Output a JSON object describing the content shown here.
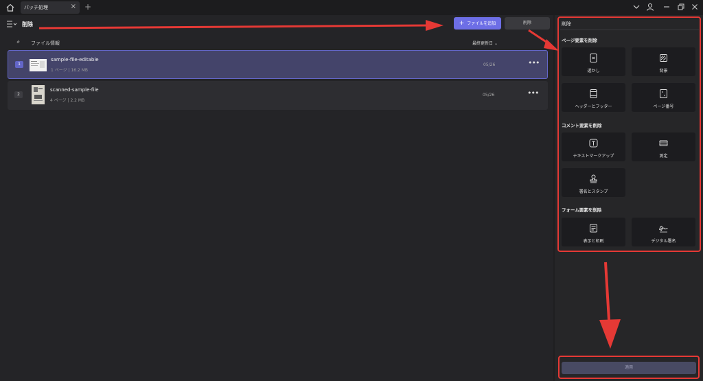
{
  "titlebar": {
    "tab_label": "バッチ処理",
    "tab_close": "×",
    "tab_add": "+",
    "controls": [
      "chevron-down-icon",
      "account-icon",
      "minimize-icon",
      "restore-icon",
      "close-icon"
    ]
  },
  "toolbar": {
    "title": "削除",
    "add_files_label": "ファイルを追加",
    "delete_label": "削除"
  },
  "table": {
    "col_hash": "#",
    "col_info": "ファイル情報",
    "col_date": "最終更新日"
  },
  "files": [
    {
      "index": "1",
      "name": "sample-file-editable",
      "pages": "1 ページ",
      "size": "16.2 MB",
      "date": "05/26",
      "more": "•••"
    },
    {
      "index": "2",
      "name": "scanned-sample-file",
      "pages": "4 ページ",
      "size": "2.2 MB",
      "date": "05/26",
      "more": "•••"
    }
  ],
  "panel": {
    "title": "削除",
    "page_section": "ページ要素を削除",
    "page_items": [
      {
        "label": "透かし",
        "icon": "watermark-icon"
      },
      {
        "label": "背景",
        "icon": "background-icon"
      },
      {
        "label": "ヘッダーとフッター",
        "icon": "header-footer-icon"
      },
      {
        "label": "ページ番号",
        "icon": "page-number-icon"
      }
    ],
    "comment_section": "コメント要素を削除",
    "comment_items": [
      {
        "label": "テキストマークアップ",
        "icon": "text-markup-icon"
      },
      {
        "label": "測定",
        "icon": "measure-icon"
      },
      {
        "label": "署名とスタンプ",
        "icon": "stamp-icon"
      }
    ],
    "form_section": "フォーム要素を削除",
    "form_items": [
      {
        "label": "表示と印刷",
        "icon": "display-print-icon"
      },
      {
        "label": "デジタル署名",
        "icon": "digital-signature-icon"
      }
    ],
    "apply_label": "適用"
  },
  "colors": {
    "accent": "#6d6ee6",
    "annotation": "#e53935",
    "selected_row": "#44446a"
  }
}
